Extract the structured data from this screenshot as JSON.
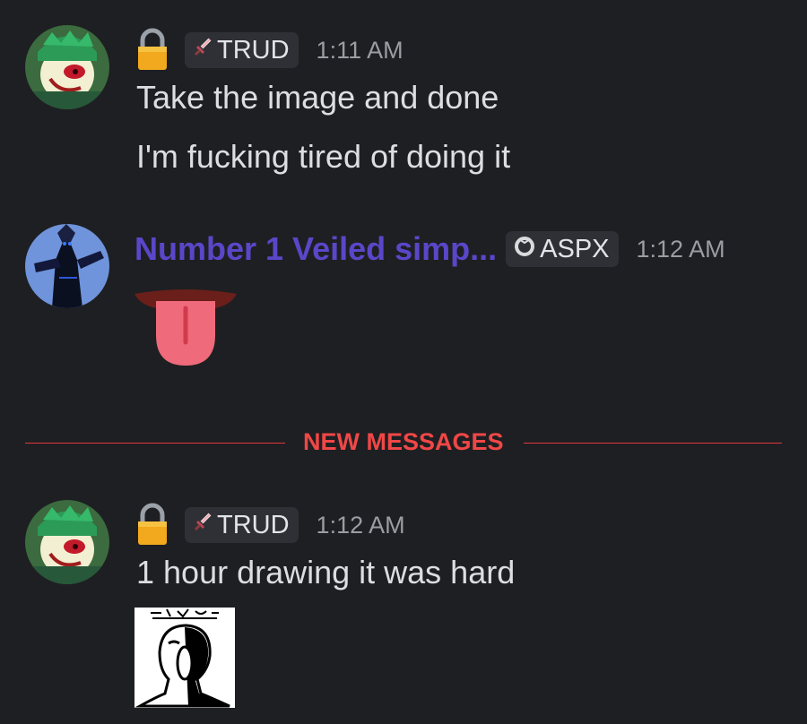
{
  "messages": [
    {
      "author_tag": "TRUD",
      "timestamp": "1:11 AM",
      "lines": [
        "Take the image and done",
        "I'm fucking tired of doing it"
      ]
    },
    {
      "author_name": "Number 1 Veiled simp...",
      "author_tag": "ASPX",
      "timestamp": "1:12 AM",
      "emoji": "tongue-emoji"
    },
    {
      "author_tag": "TRUD",
      "timestamp": "1:12 AM",
      "lines": [
        "1 hour drawing it was hard"
      ],
      "attachment": "drawn-image"
    }
  ],
  "divider": {
    "label": "NEW MESSAGES",
    "color": "#f04747"
  },
  "colors": {
    "background": "#1e1f22",
    "username": "#5b46c9",
    "tag_background": "#2e3035",
    "timestamp": "#9a9da3"
  },
  "icons": {
    "lock": "lock-icon",
    "sword": "sword-icon",
    "ring": "ring-icon"
  }
}
